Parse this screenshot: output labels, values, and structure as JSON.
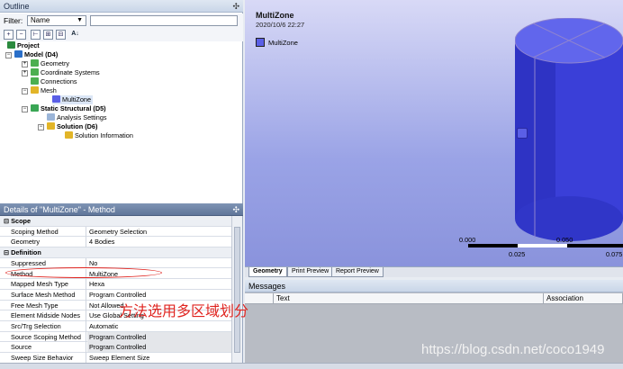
{
  "outline": {
    "title": "Outline",
    "pin": "₽",
    "filter_label": "Filter:",
    "filter_value": "Name",
    "tree": [
      {
        "label": "Project",
        "bold": true
      },
      {
        "label": "Model (D4)",
        "bold": true
      },
      {
        "label": "Geometry",
        "bold": false
      },
      {
        "label": "Coordinate Systems",
        "bold": false
      },
      {
        "label": "Connections",
        "bold": false
      },
      {
        "label": "Mesh",
        "bold": false
      },
      {
        "label": "MultiZone",
        "bold": false
      },
      {
        "label": "Static Structural (D5)",
        "bold": true
      },
      {
        "label": "Analysis Settings",
        "bold": false
      },
      {
        "label": "Solution (D6)",
        "bold": true
      },
      {
        "label": "Solution Information",
        "bold": false
      }
    ]
  },
  "details": {
    "title": "Details of \"MultiZone\" - Method",
    "pin": "₽",
    "rows": [
      {
        "key": "Scope",
        "section": true
      },
      {
        "key": "Scoping Method",
        "value": "Geometry Selection"
      },
      {
        "key": "Geometry",
        "value": "4 Bodies"
      },
      {
        "key": "Definition",
        "section": true
      },
      {
        "key": "Suppressed",
        "value": "No"
      },
      {
        "key": "Method",
        "value": "MultiZone"
      },
      {
        "key": "Mapped Mesh Type",
        "value": "Hexa"
      },
      {
        "key": "Surface Mesh Method",
        "value": "Program Controlled"
      },
      {
        "key": "Free Mesh Type",
        "value": "Not Allowed"
      },
      {
        "key": "Element Midside Nodes",
        "value": "Use Global Setting"
      },
      {
        "key": "Src/Trg Selection",
        "value": "Automatic"
      },
      {
        "key": "Source Scoping Method",
        "value": "Program Controlled",
        "shaded": true
      },
      {
        "key": "Source",
        "value": "Program Controlled",
        "shaded": true
      },
      {
        "key": "Sweep Size Behavior",
        "value": "Sweep Element Size"
      }
    ]
  },
  "viewport": {
    "title": "MultiZone",
    "date": "2020/10/6 22:27",
    "legend_label": "MultiZone",
    "legend_color": "#5a5fe6",
    "scale": {
      "left": "0.000",
      "mid1": "0.025",
      "mid2": "0.050",
      "right": "0.075"
    }
  },
  "tabs": [
    "Geometry",
    "Print Preview",
    "Report Preview"
  ],
  "messages": {
    "title": "Messages",
    "columns": [
      "Text",
      "Association"
    ]
  },
  "annotation": "方法选用多区域划分",
  "watermark": "https://blog.csdn.net/coco1949"
}
